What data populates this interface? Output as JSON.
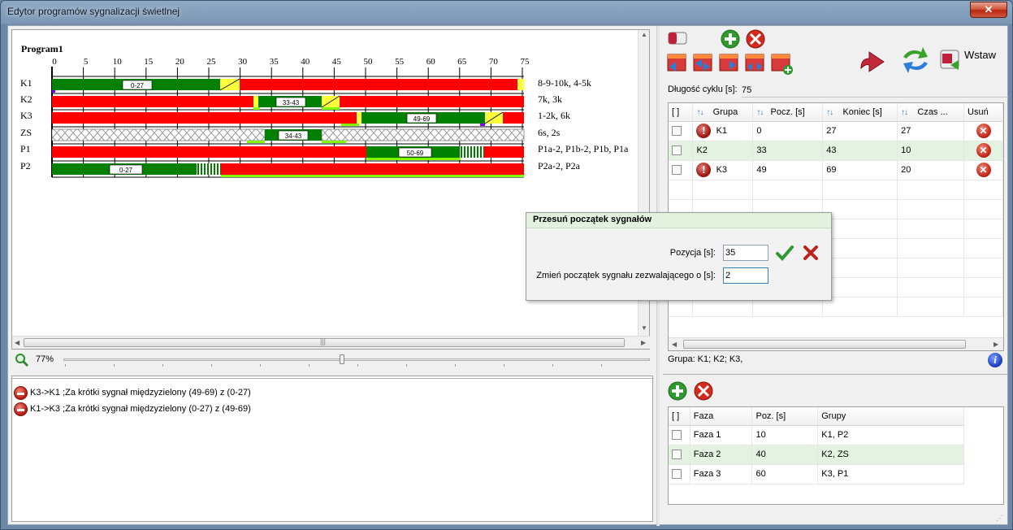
{
  "window": {
    "title": "Edytor programów sygnalizacji świetlnej",
    "close_label": "✕"
  },
  "chart": {
    "program_name": "Program1",
    "ticks": [
      "0",
      "5",
      "10",
      "15",
      "20",
      "25",
      "30",
      "35",
      "40",
      "45",
      "50",
      "55",
      "60",
      "65",
      "70",
      "75"
    ],
    "rows": [
      {
        "label": "K1",
        "detectors": "8-9-10k, 4-5k"
      },
      {
        "label": "K2",
        "detectors": "7k, 3k"
      },
      {
        "label": "K3",
        "detectors": "1-2k, 6k"
      },
      {
        "label": "ZS",
        "detectors": "6s, 2s"
      },
      {
        "label": "P1",
        "detectors": "P1a-2, P1b-2, P1b, P1a"
      },
      {
        "label": "P2",
        "detectors": "P2a-2, P2a"
      }
    ],
    "interval_labels": {
      "k1": "0-27",
      "k2": "33-43",
      "k3": "49-69",
      "zs": "34-43",
      "p1": "50-69",
      "p2": "0-27"
    },
    "colors": {
      "red": "#ff0000",
      "green": "#008000",
      "yellow": "#ffff3c",
      "light_green": "#80ff00"
    }
  },
  "zoom": {
    "value": "77%"
  },
  "log": {
    "items": [
      "K3->K1 ;Za krótki sygnał międzyzielony (49-69) z (0-27)",
      "K1->K3 ;Za krótki sygnał międzyzielony (0-27) z (49-69)"
    ]
  },
  "toolbar": {
    "insert_label": "Wstaw"
  },
  "cycle": {
    "label": "Długość cyklu [s]:",
    "value": "75"
  },
  "groups_table": {
    "headers": {
      "check": "[ ]",
      "group": "Grupa",
      "start": "Pocz. [s]",
      "end": "Koniec [s]",
      "duration": "Czas ...",
      "delete": "Usuń"
    },
    "rows": [
      {
        "name": "K1",
        "start": "0",
        "end": "27",
        "duration": "27",
        "warning": true
      },
      {
        "name": "K2",
        "start": "33",
        "end": "43",
        "duration": "10",
        "warning": false
      },
      {
        "name": "K3",
        "start": "49",
        "end": "69",
        "duration": "20",
        "warning": true
      }
    ],
    "footer": "Grupa: K1; K2; K3,"
  },
  "phases_table": {
    "headers": {
      "check": "[ ]",
      "phase": "Faza",
      "start": "Poz. [s]",
      "groups": "Grupy"
    },
    "rows": [
      {
        "name": "Faza 1",
        "start": "10",
        "groups": "K1, P2"
      },
      {
        "name": "Faza 2",
        "start": "40",
        "groups": "K2, ZS"
      },
      {
        "name": "Faza 3",
        "start": "60",
        "groups": "K3, P1"
      }
    ]
  },
  "dialog": {
    "title": "Przesuń początek sygnałów",
    "position_label": "Pozycja [s]:",
    "position_value": "35",
    "shift_label": "Zmień początek sygnału zezwalającego o [s]:",
    "shift_value": "2"
  }
}
